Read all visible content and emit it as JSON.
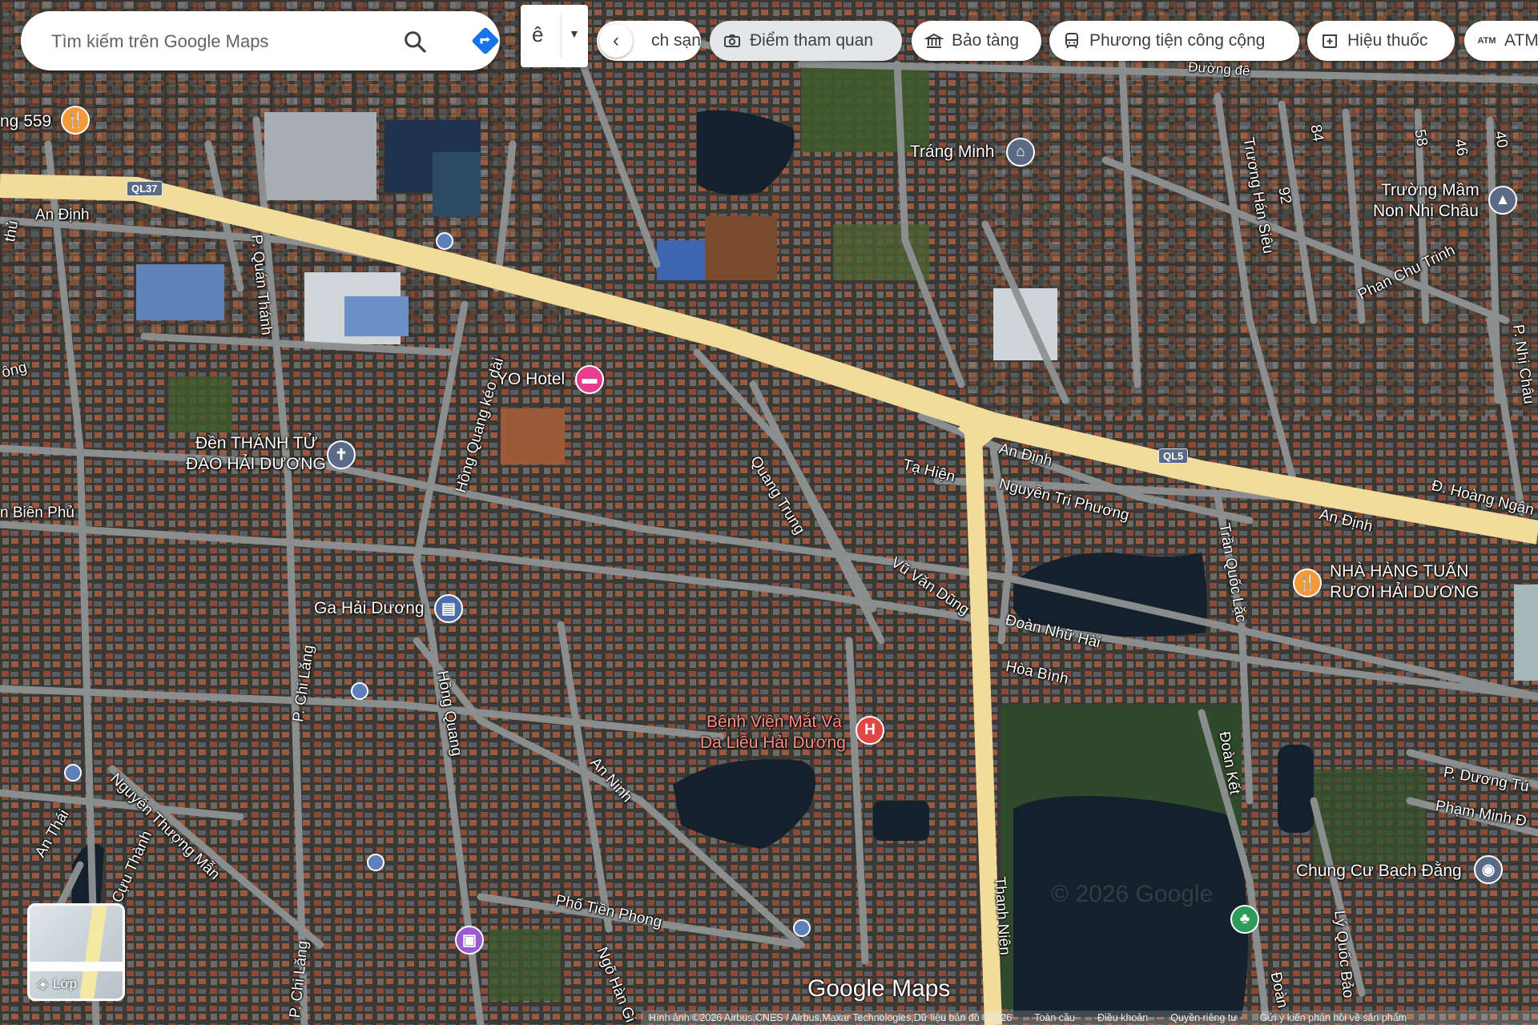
{
  "search": {
    "placeholder": "Tìm kiếm trên Google Maps"
  },
  "collapse_char": "ê",
  "chips": {
    "hotel": "ch sạn",
    "attractions": "Điểm tham quan",
    "museums": "Bảo tàng",
    "transit": "Phương tiện công cộng",
    "pharmacy": "Hiệu thuốc",
    "atm": "ATM"
  },
  "poi": {
    "restaurant_559": "ng 559",
    "trang_minh": "Tráng Minh",
    "truong_mam_non_1": "Trường Mầm",
    "truong_mam_non_2": "Non Nhị Châu",
    "yo_hotel": "YO Hotel",
    "den_1": "Đền THÁNH TỬ",
    "den_2": "ĐẠO HẢI DƯƠNG",
    "ga": "Ga Hải Dương",
    "nha_hang_1": "NHÀ HÀNG TUẤN",
    "nha_hang_2": "RƯƠI HẢI DƯƠNG",
    "benh_vien_1": "Bệnh Viện Mắt Và",
    "benh_vien_2": "Da Liễu Hải Dương",
    "chung_cu": "Chung Cư Bạch Đằng"
  },
  "streets": {
    "an_dinh_w": "An Định",
    "quan_thanh": "P. Quán Thánh",
    "hong_quang_kd": "Hồng Quang kéo dài",
    "quang_trung": "Quang Trung",
    "ta_hien": "Tạ Hiện",
    "an_dinh_c": "An Định",
    "nguyen_tri_phuong": "Nguyễn Tri Phương",
    "vu_van_dung": "Vũ Văn Dũng",
    "doan_nhu_hai": "Đoàn Nhữ Hài",
    "hoa_binh": "Hòa Bình",
    "tran_quoc_lac": "Trần Quốc Lặc",
    "an_dinh_e": "An Định",
    "hoang_ngan": "Đ. Hoàng Ngân",
    "truong_han_sieu": "Trương Hán Siêu",
    "phan_chu_trinh": "Phan Chu Trinh",
    "nhi_chau": "P. Nhị Châu",
    "s92": "92",
    "s84": "84",
    "s58": "58",
    "s46": "46",
    "s40": "40",
    "bien_phu": "n Biên Phủ",
    "chi_lang": "P. Chi Lăng",
    "hong_quang": "Hồng Quang",
    "an_ninh": "An Ninh",
    "nguyen_thuong_man": "Nguyễn Thượng Mẫn",
    "cuu_thanh": "Cựu Thành",
    "an_thai": "An Thái",
    "pho_tien_phong": "Phố Tiền Phong",
    "ngo_han_giang": "Ngõ Hàn Gi",
    "thanh_nien": "Thanh Niên",
    "doan_ket": "Đoàn Kết",
    "doan": "Đoàn",
    "ly_quoc_bao": "Lý Quốc Bảo",
    "p_duong": "P. Dương Tú",
    "pham_minh": "Phạm Minh Đ",
    "chi_lang_s": "P. Chi Lăng",
    "duong_de": "Đường đê",
    "ong_w": "ông",
    "thu_w": "thủ"
  },
  "badges": {
    "ql37": "QL37",
    "ql5": "QL5"
  },
  "layers_label": "Lớp",
  "logo": "Google Maps",
  "watermark": "© 2026 Google",
  "footer": {
    "imagery": "Hình ảnh ©2026 Airbus,CNES / Airbus,Maxar Technologies,Dữ liệu bản đồ ©2026",
    "global": "Toàn cầu",
    "terms": "Điều khoản",
    "privacy": "Quyền riêng tư",
    "feedback": "Gửi ý kiến phản hồi về sản phẩm"
  },
  "colors": {
    "highway": "#f1dc9b",
    "street": "#8e9293",
    "water": "#14202c",
    "park": "#314a2b"
  }
}
